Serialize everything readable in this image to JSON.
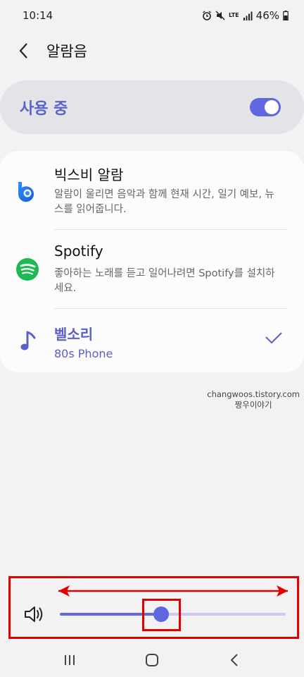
{
  "status_bar": {
    "time": "10:14",
    "icons": [
      "alarm-icon",
      "mute-icon",
      "lte-icon",
      "signal-icon"
    ],
    "lte_label": "LTE",
    "battery": "46%"
  },
  "header": {
    "title": "알람음"
  },
  "toggle": {
    "label": "사용 중",
    "on": true
  },
  "options": [
    {
      "icon": "bixby-icon",
      "title": "빅스비 알람",
      "description": "알람이 울리면 음악과 함께 현재 시간, 일기 예보, 뉴스를 읽어줍니다."
    },
    {
      "icon": "spotify-icon",
      "title": "Spotify",
      "description": "좋아하는 노래를 듣고 일어나려면 Spotify를 설치하세요."
    },
    {
      "icon": "music-note-icon",
      "title": "벨소리",
      "subtitle": "80s Phone",
      "selected": true
    }
  ],
  "watermark": {
    "line1": "changwoos.tistory.com",
    "line2": "짱우이야기"
  },
  "volume": {
    "level": 0.45
  },
  "nav": {
    "buttons": [
      "recent-apps-icon",
      "home-icon",
      "back-icon"
    ]
  },
  "colors": {
    "accent": "#5f66e0",
    "highlight_box": "#e00000",
    "spotify": "#1db954",
    "bixby": "#1a73e8"
  }
}
